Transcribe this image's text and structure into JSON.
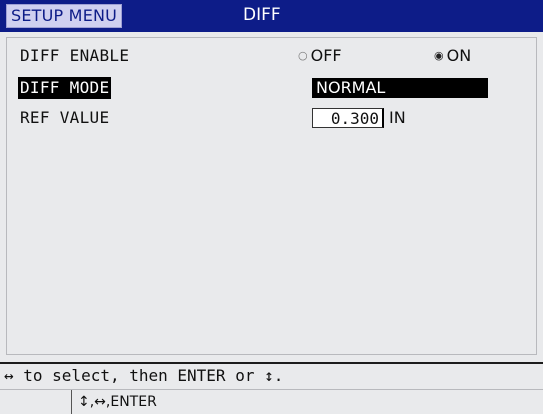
{
  "header": {
    "menu_label": "SETUP MENU",
    "title": "DIFF"
  },
  "rows": {
    "diff_enable": {
      "label": "DIFF ENABLE",
      "options": [
        {
          "label": "OFF",
          "selected": false
        },
        {
          "label": "ON",
          "selected": true
        }
      ]
    },
    "diff_mode": {
      "label": "DIFF MODE",
      "value": "NORMAL"
    },
    "ref_value": {
      "label": "REF VALUE",
      "value": "0.300",
      "unit": "IN"
    }
  },
  "help_text": "↔ to select, then ENTER or ↕.",
  "status_hint": "↕,↔,ENTER",
  "colors": {
    "title_bar": "#0d1c88",
    "panel_bg": "#e9eaec",
    "highlight": "#000000"
  }
}
